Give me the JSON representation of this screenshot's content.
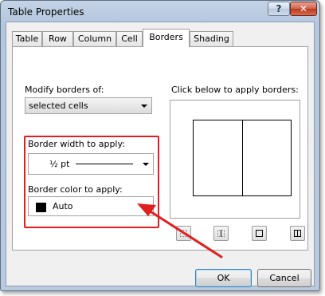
{
  "window": {
    "title": "Table Properties",
    "help_label": "?",
    "close_label": "✕"
  },
  "tabs": [
    {
      "label": "Table"
    },
    {
      "label": "Row"
    },
    {
      "label": "Column"
    },
    {
      "label": "Cell"
    },
    {
      "label": "Borders"
    },
    {
      "label": "Shading"
    }
  ],
  "borders": {
    "modify_label": "Modify borders of:",
    "modify_value": "selected cells",
    "width_label": "Border width to apply:",
    "width_value": "½ pt",
    "color_label": "Border color to apply:",
    "color_value": "Auto",
    "color_swatch": "#000000",
    "apply_label": "Click below to apply borders:"
  },
  "border_buttons": [
    {
      "icon": "no-border-icon"
    },
    {
      "icon": "inside-vertical-border-icon"
    },
    {
      "icon": "outside-border-icon"
    },
    {
      "icon": "all-borders-icon"
    }
  ],
  "annotation": {
    "highlight_color": "#e02020"
  },
  "footer": {
    "ok_label": "OK",
    "cancel_label": "Cancel"
  }
}
